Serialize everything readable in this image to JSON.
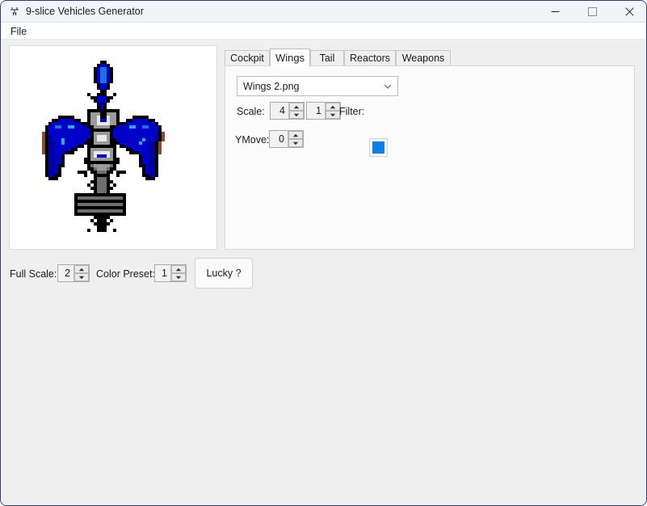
{
  "window": {
    "title": "9-slice Vehicles Generator",
    "icon": "app-icon",
    "controls": {
      "minimize": "minimize-icon",
      "maximize": "maximize-icon",
      "close": "close-icon"
    }
  },
  "menubar": {
    "items": [
      {
        "label": "File"
      }
    ]
  },
  "preview": {
    "label": "vehicle-sprite-preview",
    "sprite_description": "blue pixel-art spaceship with swept wings"
  },
  "tabs": [
    {
      "label": "Cockpit",
      "selected": false
    },
    {
      "label": "Wings",
      "selected": true
    },
    {
      "label": "Tail",
      "selected": false
    },
    {
      "label": "Reactors",
      "selected": false
    },
    {
      "label": "Weapons",
      "selected": false
    }
  ],
  "wings_panel": {
    "asset_select": {
      "value": "Wings 2.png"
    },
    "scale": {
      "label": "Scale:",
      "x_value": "4",
      "y_value": "1"
    },
    "filter": {
      "label": "Filter:",
      "color": "#0e7fe8"
    },
    "ymove": {
      "label": "YMove:",
      "value": "0"
    }
  },
  "bottom_bar": {
    "full_scale": {
      "label": "Full Scale:",
      "value": "2"
    },
    "color_preset": {
      "label": "Color Preset:",
      "value": "1"
    },
    "lucky_button": "Lucky ?"
  }
}
